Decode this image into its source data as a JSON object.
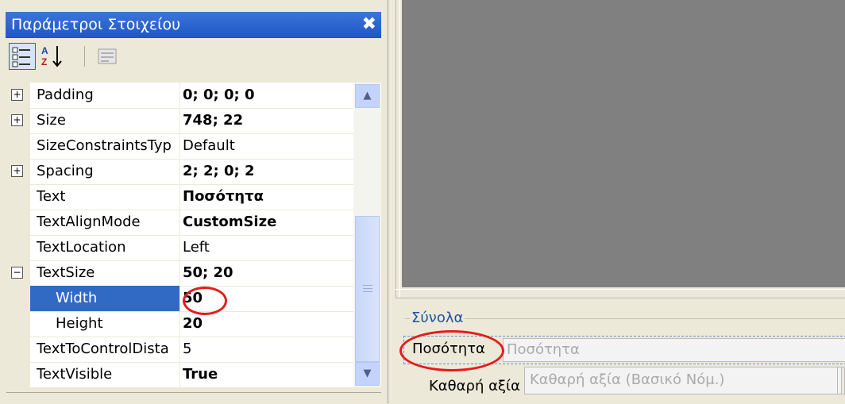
{
  "panel": {
    "title": "Παράμετροι Στοιχείου",
    "close_glyph": "✖",
    "toolbar": {
      "categorized_icon": "categorized-icon",
      "alphabetical_label": "A↓",
      "property_pages_icon": "property-pages-icon"
    }
  },
  "properties": [
    {
      "name": "Padding",
      "value": "0; 0; 0; 0",
      "bold": true,
      "expander": "+",
      "sub": false
    },
    {
      "name": "Size",
      "value": "748; 22",
      "bold": true,
      "expander": "+",
      "sub": false
    },
    {
      "name": "SizeConstraintsTyp",
      "value": "Default",
      "bold": false,
      "expander": "",
      "sub": false
    },
    {
      "name": "Spacing",
      "value": "2; 2; 0; 2",
      "bold": true,
      "expander": "+",
      "sub": false
    },
    {
      "name": "Text",
      "value": "Ποσότητα",
      "bold": true,
      "expander": "",
      "sub": false
    },
    {
      "name": "TextAlignMode",
      "value": "CustomSize",
      "bold": true,
      "expander": "",
      "sub": false
    },
    {
      "name": "TextLocation",
      "value": "Left",
      "bold": false,
      "expander": "",
      "sub": false
    },
    {
      "name": "TextSize",
      "value": "50; 20",
      "bold": true,
      "expander": "−",
      "sub": false
    },
    {
      "name": "Width",
      "value": "50",
      "bold": true,
      "expander": "",
      "sub": true,
      "selected": true
    },
    {
      "name": "Height",
      "value": "20",
      "bold": true,
      "expander": "",
      "sub": true
    },
    {
      "name": "TextToControlDista",
      "value": "5",
      "bold": false,
      "expander": "",
      "sub": false
    },
    {
      "name": "TextVisible",
      "value": "True",
      "bold": true,
      "expander": "",
      "sub": false
    }
  ],
  "scrollbar": {
    "up_glyph": "▲",
    "down_glyph": "▼"
  },
  "designer": {
    "group_title": "Σύνολα",
    "qty_label": "Ποσότητα",
    "qty_value": "Ποσότητα",
    "net_label": "Καθαρή αξία",
    "net_value": "Καθαρή αξία (Βασικό Νόμ.)"
  },
  "colors": {
    "titlebar": "#2a63d0",
    "selection": "#316ac5",
    "annotation": "#e41c1c"
  }
}
